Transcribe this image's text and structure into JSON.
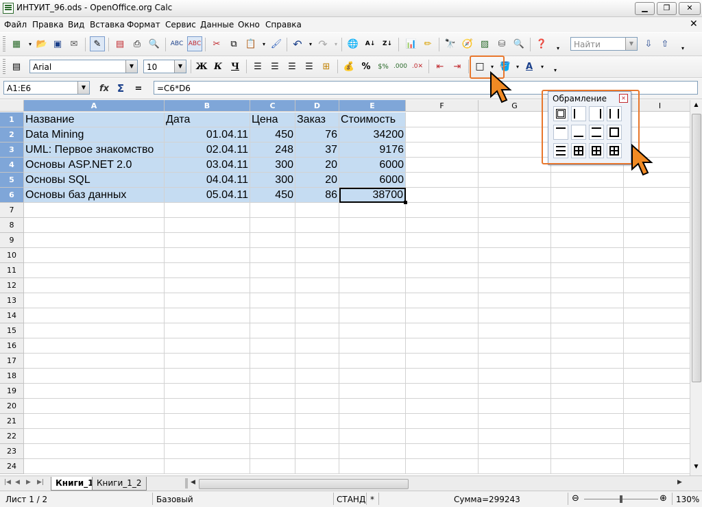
{
  "window": {
    "title": "ИНТУИТ_96.ods - OpenOffice.org Calc"
  },
  "menu": [
    "Файл",
    "Правка",
    "Вид",
    "Вставка",
    "Формат",
    "Сервис",
    "Данные",
    "Окно",
    "Справка"
  ],
  "toolbar": {
    "find_placeholder": "Найти"
  },
  "format": {
    "font_name": "Arial",
    "font_size": "10",
    "bold_label": "Ж",
    "italic_label": "К",
    "underline_label": "Ч"
  },
  "formula": {
    "name_box": "A1:E6",
    "content": "=C6*D6",
    "equals": "="
  },
  "sheet": {
    "columns": [
      "A",
      "B",
      "C",
      "D",
      "E",
      "F",
      "G",
      "H",
      "I"
    ],
    "rows": [
      "1",
      "2",
      "3",
      "4",
      "5",
      "6",
      "7",
      "8",
      "9",
      "10",
      "11",
      "12",
      "13",
      "14",
      "15",
      "16",
      "17",
      "18",
      "19",
      "20",
      "21",
      "22",
      "23",
      "24"
    ],
    "table": [
      [
        "Название",
        "Дата",
        "Цена",
        "Заказ",
        "Стоимость"
      ],
      [
        "Data Mining",
        "01.04.11",
        "450",
        "76",
        "34200"
      ],
      [
        "UML: Первое знакомство",
        "02.04.11",
        "248",
        "37",
        "9176"
      ],
      [
        "Основы ASP.NET 2.0",
        "03.04.11",
        "300",
        "20",
        "6000"
      ],
      [
        "Основы SQL",
        "04.04.11",
        "300",
        "20",
        "6000"
      ],
      [
        "Основы баз данных",
        "05.04.11",
        "450",
        "86",
        "38700"
      ]
    ]
  },
  "panel": {
    "title": "Обрамление"
  },
  "tabs": [
    "Книги_1",
    "Книги_1_2"
  ],
  "status": {
    "sheet": "Лист 1 / 2",
    "style": "Базовый",
    "mode": "СТАНД",
    "modified": "*",
    "sum": "Сумма=299243",
    "zoom": "130%"
  },
  "colors": {
    "selection": "#c5dcf2",
    "header_selected": "#7fa6d8",
    "highlight": "#e8762b"
  }
}
